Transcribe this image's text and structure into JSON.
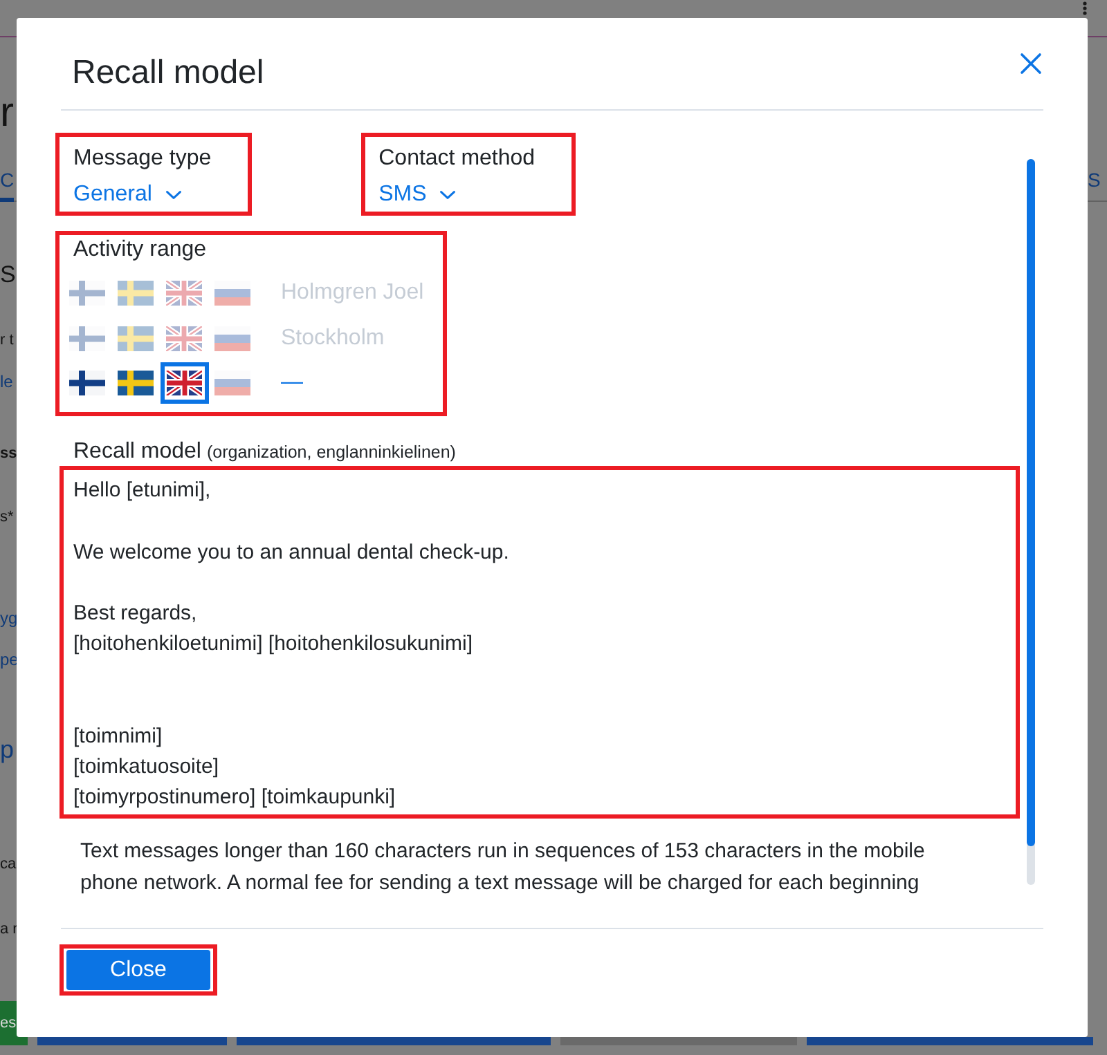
{
  "page": {
    "heading": "r",
    "tabs": [
      {
        "label": "C",
        "selected": true
      },
      {
        "label": "S",
        "selected": false
      }
    ],
    "section_title": "S",
    "fragments": [
      {
        "kind": "text",
        "text": "r t"
      },
      {
        "kind": "link",
        "text": "le"
      },
      {
        "kind": "bold",
        "text": "ss"
      },
      {
        "kind": "text",
        "text": "s*"
      },
      {
        "kind": "large-link",
        "text": "yg"
      },
      {
        "kind": "large-link",
        "text": "pe"
      },
      {
        "kind": "xl-link",
        "text": "p"
      },
      {
        "kind": "text",
        "text": "ca"
      },
      {
        "kind": "text",
        "text": "a r"
      }
    ],
    "buttons": [
      {
        "kind": "success",
        "label": "es"
      },
      {
        "kind": "primary"
      },
      {
        "kind": "primary"
      },
      {
        "kind": "secondary"
      },
      {
        "kind": "primary"
      }
    ]
  },
  "dialog": {
    "title": "Recall model",
    "message_type": {
      "label": "Message type",
      "value": "General",
      "highlighted": true
    },
    "contact_method": {
      "label": "Contact method",
      "value": "SMS",
      "highlighted": true
    },
    "activity_range": {
      "label": "Activity range",
      "highlighted": true,
      "rows": [
        {
          "label": "Holmgren Joel",
          "disabled": true,
          "flags": [
            {
              "kind": "fi",
              "disabled": true,
              "selected": false
            },
            {
              "kind": "se",
              "disabled": true,
              "selected": false
            },
            {
              "kind": "gb",
              "disabled": true,
              "selected": false
            },
            {
              "kind": "ru",
              "disabled": true,
              "selected": false
            }
          ]
        },
        {
          "label": "Stockholm",
          "disabled": true,
          "flags": [
            {
              "kind": "fi",
              "disabled": true,
              "selected": false
            },
            {
              "kind": "se",
              "disabled": true,
              "selected": false
            },
            {
              "kind": "gb",
              "disabled": true,
              "selected": false
            },
            {
              "kind": "ru",
              "disabled": true,
              "selected": false
            }
          ]
        },
        {
          "label": "—",
          "disabled": false,
          "flags": [
            {
              "kind": "fi",
              "disabled": false,
              "selected": false
            },
            {
              "kind": "se",
              "disabled": false,
              "selected": false
            },
            {
              "kind": "gb",
              "disabled": false,
              "selected": true
            },
            {
              "kind": "ru",
              "disabled": true,
              "selected": false
            }
          ]
        }
      ]
    },
    "recall_model": {
      "label": "Recall model",
      "note": "(organization, englanninkielinen)",
      "value": "Hello [etunimi],\n\nWe welcome you to an annual dental check-up.\n\nBest regards,\n[hoitohenkiloetunimi] [hoitohenkilosukunimi]\n\n\n[toimnimi]\n[toimkatuosoite]\n[toimyrpostinumero] [toimkaupunki]",
      "highlighted": true
    },
    "info": "Text messages longer than 160 characters run in sequences of 153 characters in the mobile phone network. A normal fee for sending a text message will be charged for each beginning",
    "close_button": {
      "label": "Close",
      "highlighted": true
    }
  }
}
